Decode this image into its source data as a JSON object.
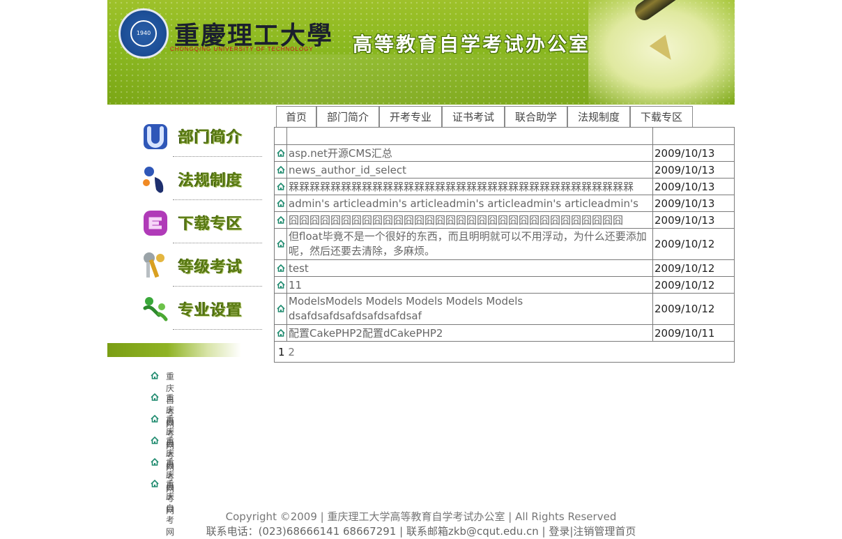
{
  "header": {
    "university_name": "重慶理工大學",
    "university_en": "CHONGQING   UNIVERSITY   OF   TECHNOLOGY",
    "logo_year": "1940",
    "office_title": "高等教育自学考试办公室"
  },
  "tabs": [
    {
      "label": "首页"
    },
    {
      "label": "部门简介"
    },
    {
      "label": "开考专业"
    },
    {
      "label": "证书考试"
    },
    {
      "label": "联合助学"
    },
    {
      "label": "法规制度"
    },
    {
      "label": "下载专区"
    }
  ],
  "sidebar": {
    "items": [
      {
        "label": "部门简介",
        "icon": "letter-u-icon"
      },
      {
        "label": "法规制度",
        "icon": "figure-icon"
      },
      {
        "label": "下载专区",
        "icon": "letter-e-icon"
      },
      {
        "label": "等级考试",
        "icon": "keys-icon"
      },
      {
        "label": "专业设置",
        "icon": "people-icon"
      }
    ],
    "links": [
      {
        "label": "重庆自考网"
      },
      {
        "label": "重庆自考网"
      },
      {
        "label": "重庆自考网"
      },
      {
        "label": "重庆自考网"
      },
      {
        "label": "重庆自考网"
      },
      {
        "label": "重庆自考网"
      }
    ]
  },
  "news": {
    "rows": [
      {
        "title": "asp.net开源CMS汇总",
        "date": "2009/10/13"
      },
      {
        "title": "news_author_id_select",
        "date": "2009/10/13"
      },
      {
        "title": "槑槑槑槑槑槑槑槑槑槑槑槑槑槑槑槑槑槑槑槑槑槑槑槑槑槑槑槑槑槑槑槑槑",
        "date": "2009/10/13"
      },
      {
        "title": "admin's articleadmin's articleadmin's articleadmin's articleadmin's",
        "date": "2009/10/13"
      },
      {
        "title": "囧囧囧囧囧囧囧囧囧囧囧囧囧囧囧囧囧囧囧囧囧囧囧囧囧囧囧囧囧囧囧囧",
        "date": "2009/10/13"
      },
      {
        "title": "但float毕竟不是一个很好的东西，而且明明就可以不用浮动，为什么还要添加呢，然后还要去清除，多麻烦。",
        "date": "2009/10/12"
      },
      {
        "title": "test",
        "date": "2009/10/12"
      },
      {
        "title": "11",
        "date": "2009/10/12"
      },
      {
        "title": "ModelsModels Models Models Models Models dsafdsafdsafdsafdsafdsaf",
        "date": "2009/10/12"
      },
      {
        "title": "配置CakePHP2配置dCakePHP2",
        "date": "2009/10/11"
      }
    ],
    "pager": {
      "current": "1",
      "next": "2"
    }
  },
  "footer": {
    "line1": "Copyright ©2009 | 重庆理工大学高等教育自学考试办公室 | All Rights Reserved",
    "contact": "联系电话：(023)68666141 68667291 | 联系邮箱zkb@cqut.edu.cn | ",
    "login": "登录",
    "sep": "|",
    "logout": "注销",
    "admin_home": "管理首页"
  },
  "colors": {
    "banner_green": "#8ab81f",
    "sidebar_label": "#5b7c14",
    "icon_teal": "#1e8a6e"
  }
}
